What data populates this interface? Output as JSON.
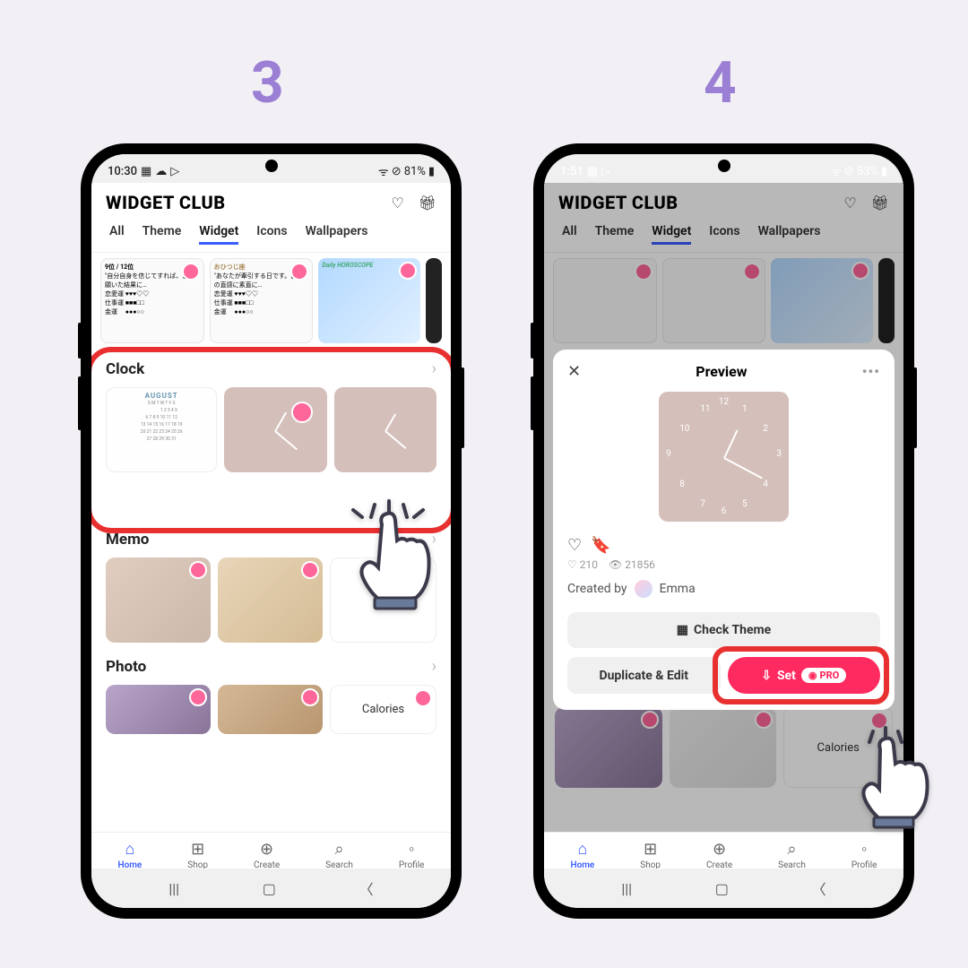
{
  "steps": {
    "s3": "3",
    "s4": "4"
  },
  "status": {
    "left_time": "10:30",
    "left_time2": "1:51",
    "battery1": "81%",
    "battery2": "53%"
  },
  "app": {
    "title": "WIDGET CLUB",
    "tabs": [
      "All",
      "Theme",
      "Widget",
      "Icons",
      "Wallpapers"
    ],
    "active_tab": "Widget"
  },
  "horo": {
    "c1_title": "9位 / 12位",
    "c1_sub": "\"自分自身を信じてすれば、思い願いた結果に…",
    "c2_title": "おひつじ座",
    "c2_sub": "\"あなたが牽引する日です。自分の直感に素直に…",
    "c3_title": "Daily HOROSCOPE"
  },
  "sections": {
    "clock": "Clock",
    "memo": "Memo",
    "photo": "Photo",
    "cal_month": "AUGUST",
    "calories": "Calories"
  },
  "nav": {
    "items": [
      {
        "icon": "⌂",
        "label": "Home"
      },
      {
        "icon": "⊞",
        "label": "Shop"
      },
      {
        "icon": "⊕",
        "label": "Create"
      },
      {
        "icon": "⌕",
        "label": "Search"
      },
      {
        "icon": "◦",
        "label": "Profile"
      }
    ]
  },
  "preview": {
    "title": "Preview",
    "likes": "210",
    "views": "21856",
    "created_by": "Created by",
    "creator": "Emma",
    "check_theme": "Check Theme",
    "duplicate": "Duplicate & Edit",
    "set": "Set",
    "pro": "PRO"
  }
}
